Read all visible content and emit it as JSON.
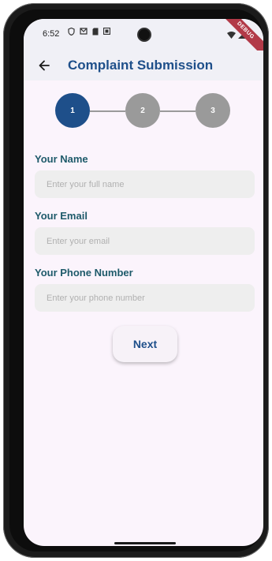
{
  "status_bar": {
    "time": "6:52",
    "debug_banner": "DEBUG"
  },
  "app_bar": {
    "title": "Complaint Submission"
  },
  "stepper": {
    "steps": [
      "1",
      "2",
      "3"
    ],
    "active_step": 1
  },
  "form": {
    "name": {
      "label": "Your Name",
      "placeholder": "Enter your full name",
      "value": ""
    },
    "email": {
      "label": "Your Email",
      "placeholder": "Enter your email",
      "value": ""
    },
    "phone": {
      "label": "Your Phone Number",
      "placeholder": "Enter your phone number",
      "value": ""
    }
  },
  "next_button": {
    "label": "Next"
  },
  "colors": {
    "primary": "#1e4f8a",
    "label": "#1e5a6a",
    "inactive_step": "#9a9a9a",
    "background": "#fbf4fc",
    "input_bg": "#eeeeee"
  }
}
